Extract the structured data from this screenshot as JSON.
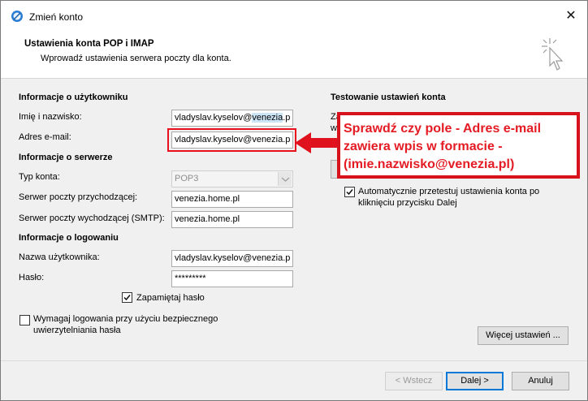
{
  "window": {
    "title": "Zmień konto"
  },
  "header": {
    "title": "Ustawienia konta POP i IMAP",
    "subtitle": "Wprowadź ustawienia serwera poczty dla konta."
  },
  "user_info": {
    "section": "Informacje o użytkowniku",
    "name_label": "Imię i nazwisko:",
    "name_prefix": "vladyslav.kyselov@",
    "name_highlight": "venezia",
    "name_suffix": ".p",
    "email_label": "Adres e-mail:",
    "email_value": "vladyslav.kyselov@venezia.p"
  },
  "server_info": {
    "section": "Informacje o serwerze",
    "account_type_label": "Typ konta:",
    "account_type_value": "POP3",
    "incoming_label": "Serwer poczty przychodzącej:",
    "incoming_value": "venezia.home.pl",
    "outgoing_label": "Serwer poczty wychodzącej (SMTP):",
    "outgoing_value": "venezia.home.pl"
  },
  "login_info": {
    "section": "Informacje o logowaniu",
    "username_label": "Nazwa użytkownika:",
    "username_value": "vladyslav.kyselov@venezia.p",
    "password_label": "Hasło:",
    "password_value": "*********",
    "remember_label": "Zapamiętaj hasło",
    "remember_checked": true,
    "spa_label_1": "Wymagaj logowania przy użyciu bezpiecznego",
    "spa_label_2": "uwierzytelniania hasła",
    "spa_checked": false
  },
  "test": {
    "section": "Testowanie ustawień konta",
    "partial_1": "Za",
    "partial_2": "w",
    "auto_test_label_1": "Automatycznie przetestuj ustawienia konta po",
    "auto_test_label_2": "kliknięciu przycisku Dalej",
    "auto_test_checked": true
  },
  "annotation": {
    "line1": "Sprawdź czy pole - Adres e-mail",
    "line2": "zawiera wpis w formacie -",
    "line3": "(imie.nazwisko@venezia.pl)",
    "color": "#e51b24"
  },
  "buttons": {
    "more_settings": "Więcej ustawień ...",
    "back": "< Wstecz",
    "next": "Dalej >",
    "cancel": "Anuluj"
  },
  "icons": {
    "app": "outlook-icon",
    "close": "close-icon",
    "cursor": "click-cursor-icon",
    "arrow": "red-arrow-left"
  }
}
